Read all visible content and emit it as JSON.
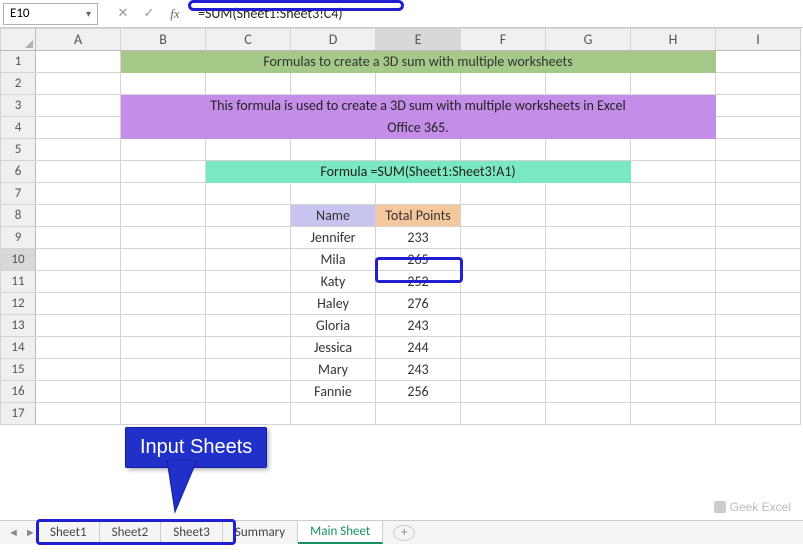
{
  "nameBox": "E10",
  "formula": "=SUM(Sheet1:Sheet3!C4)",
  "columns": [
    "A",
    "B",
    "C",
    "D",
    "E",
    "F",
    "G",
    "H",
    "I"
  ],
  "rows": [
    "1",
    "2",
    "3",
    "4",
    "5",
    "6",
    "7",
    "8",
    "9",
    "10",
    "11",
    "12",
    "13",
    "14",
    "15",
    "16",
    "17"
  ],
  "activeRow": "10",
  "activeCol": "E",
  "title": "Formulas to create a 3D sum with multiple worksheets",
  "descriptionLine1": "This formula is used to create a 3D sum with multiple worksheets in Excel",
  "descriptionLine2": "Office 365.",
  "formulaText": "Formula =SUM(Sheet1:Sheet3!A1)",
  "headers": {
    "name": "Name",
    "total": "Total Points"
  },
  "data": [
    {
      "name": "Jennifer",
      "total": 233
    },
    {
      "name": "Mila",
      "total": 265
    },
    {
      "name": "Katy",
      "total": 252
    },
    {
      "name": "Haley",
      "total": 276
    },
    {
      "name": "Gloria",
      "total": 243
    },
    {
      "name": "Jessica",
      "total": 244
    },
    {
      "name": "Mary",
      "total": 243
    },
    {
      "name": "Fannie",
      "total": 256
    }
  ],
  "sheets": [
    {
      "label": "Sheet1",
      "active": false
    },
    {
      "label": "Sheet2",
      "active": false
    },
    {
      "label": "Sheet3",
      "active": false
    },
    {
      "label": "Summary",
      "active": false
    },
    {
      "label": "Main Sheet",
      "active": true
    }
  ],
  "calloutLabel": "Input Sheets",
  "addSheetIcon": "+",
  "watermark": "Geek Excel",
  "chart_data": {
    "type": "table",
    "title": "Formulas to create a 3D sum with multiple worksheets",
    "columns": [
      "Name",
      "Total Points"
    ],
    "rows": [
      [
        "Jennifer",
        233
      ],
      [
        "Mila",
        265
      ],
      [
        "Katy",
        252
      ],
      [
        "Haley",
        276
      ],
      [
        "Gloria",
        243
      ],
      [
        "Jessica",
        244
      ],
      [
        "Mary",
        243
      ],
      [
        "Fannie",
        256
      ]
    ]
  }
}
